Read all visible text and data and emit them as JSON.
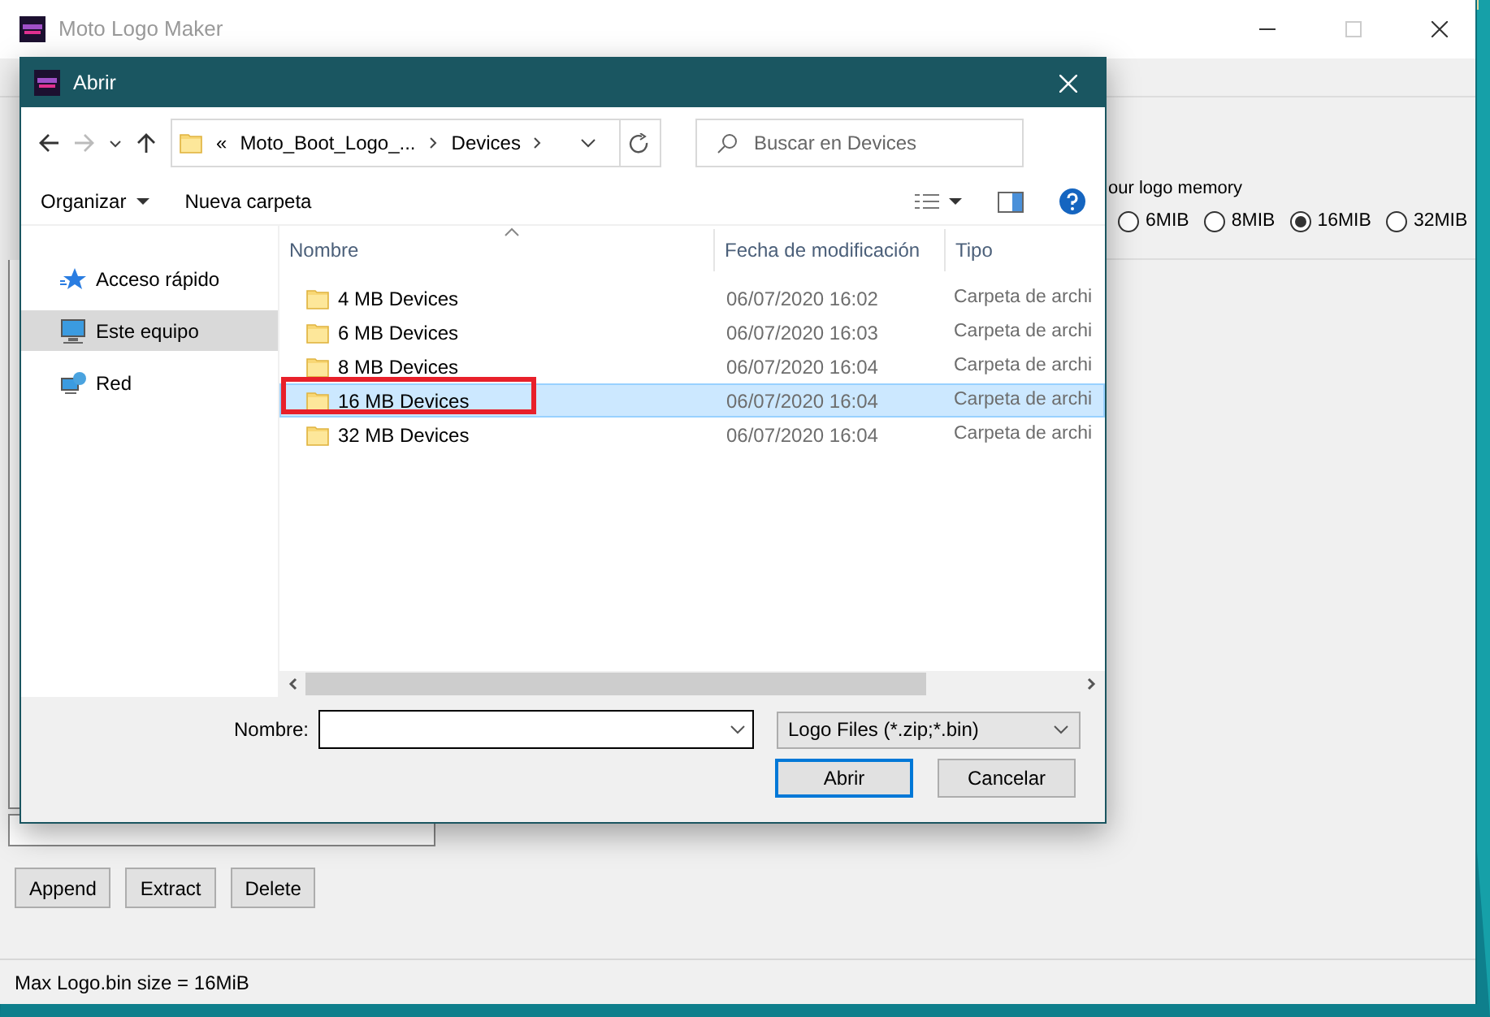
{
  "main_window": {
    "title": "Moto Logo Maker",
    "memory_group": {
      "label": "our logo memory",
      "options": [
        {
          "label": "6MIB",
          "selected": false
        },
        {
          "label": "8MIB",
          "selected": false
        },
        {
          "label": "16MIB",
          "selected": true
        },
        {
          "label": "32MIB",
          "selected": false
        }
      ]
    },
    "buttons": [
      "Append",
      "Extract",
      "Delete"
    ],
    "status_bar": "Max Logo.bin size = 16MiB"
  },
  "dialog": {
    "title": "Abrir",
    "breadcrumb_overflow": "«",
    "breadcrumb": [
      "Moto_Boot_Logo_...",
      "Devices"
    ],
    "search": {
      "placeholder": "Buscar en Devices"
    },
    "commands": [
      "Organizar",
      "Nueva carpeta"
    ],
    "nav_items": [
      {
        "label": "Acceso rápido",
        "kind": "star",
        "selected": false
      },
      {
        "label": "Este equipo",
        "kind": "computer",
        "selected": true
      },
      {
        "label": "Red",
        "kind": "network",
        "selected": false
      }
    ],
    "columns": [
      "Nombre",
      "Fecha de modificación",
      "Tipo"
    ],
    "rows": [
      {
        "name": "4 MB Devices",
        "date": "06/07/2020 16:02",
        "type": "Carpeta de archi",
        "selected": false
      },
      {
        "name": "6 MB Devices",
        "date": "06/07/2020 16:03",
        "type": "Carpeta de archi",
        "selected": false
      },
      {
        "name": "8 MB Devices",
        "date": "06/07/2020 16:04",
        "type": "Carpeta de archi",
        "selected": false
      },
      {
        "name": "16 MB Devices",
        "date": "06/07/2020 16:04",
        "type": "Carpeta de archi",
        "selected": true
      },
      {
        "name": "32 MB Devices",
        "date": "06/07/2020 16:04",
        "type": "Carpeta de archi",
        "selected": false
      }
    ],
    "filename_label": "Nombre:",
    "filetype": "Logo Files (*.zip;*.bin)",
    "buttons": [
      "Abrir",
      "Cancelar"
    ]
  }
}
